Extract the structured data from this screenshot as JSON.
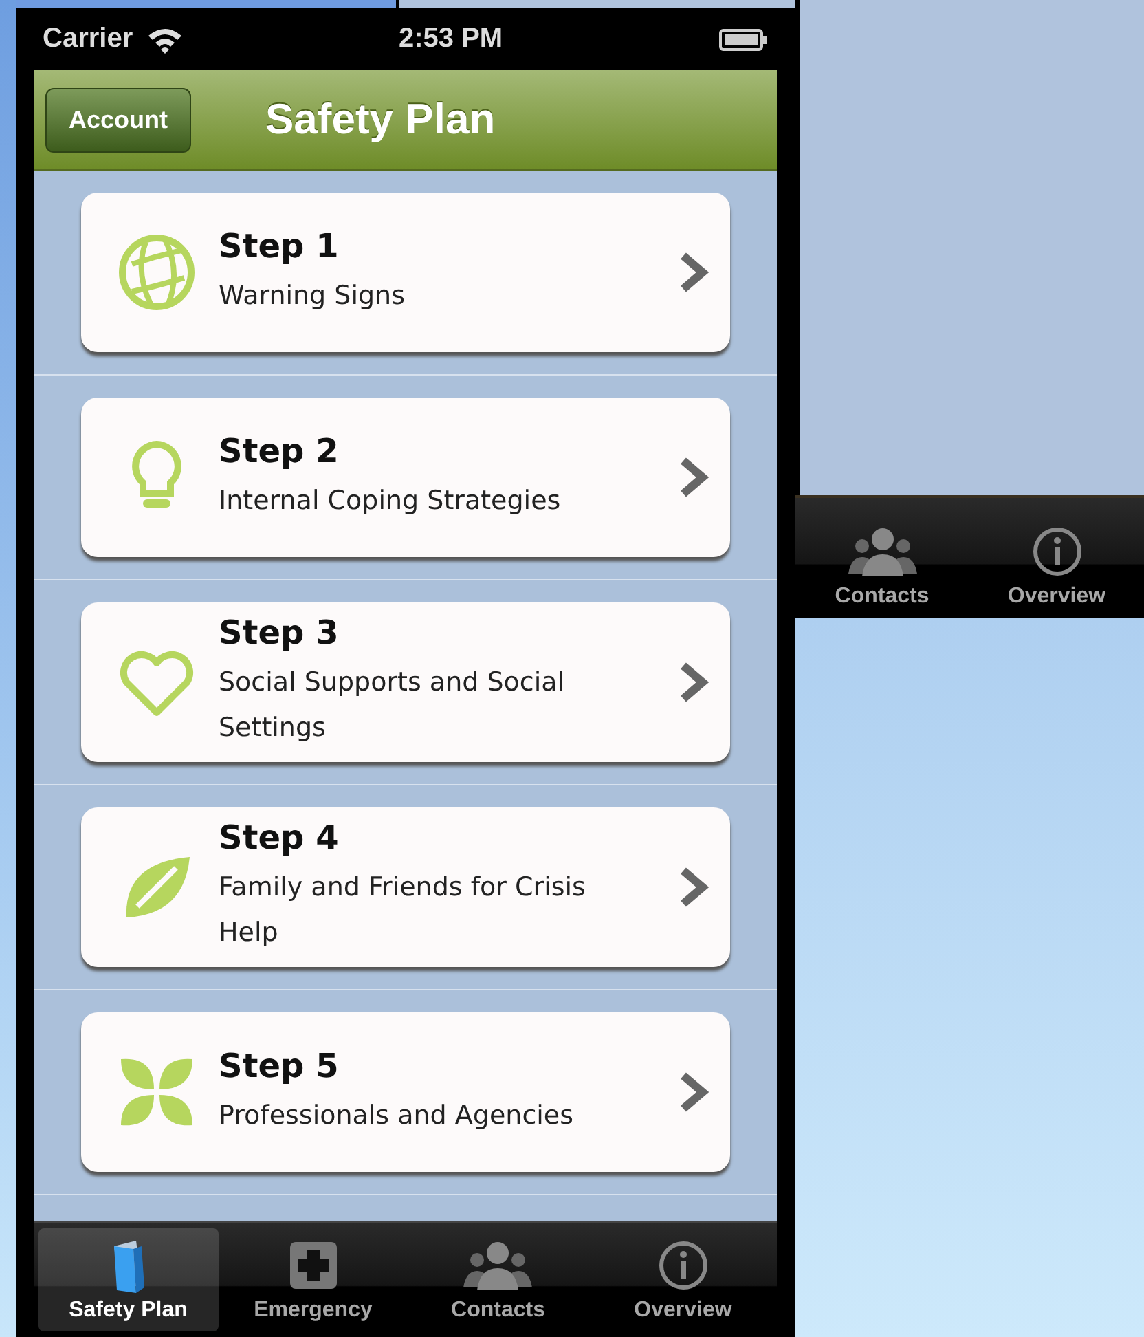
{
  "status_bar": {
    "carrier": "Carrier",
    "time": "2:53 PM"
  },
  "nav_bar": {
    "back_button": "Account",
    "title": "Safety Plan"
  },
  "steps": [
    {
      "title": "Step 1",
      "subtitle": "Warning Signs",
      "kind": "globe"
    },
    {
      "title": "Step 2",
      "subtitle": "Internal Coping Strategies",
      "kind": "bulb"
    },
    {
      "title": "Step 3",
      "subtitle": "Social Supports and Social Settings",
      "kind": "heart"
    },
    {
      "title": "Step 4",
      "subtitle": "Family and Friends for Crisis Help",
      "kind": "leaf"
    },
    {
      "title": "Step 5",
      "subtitle": "Professionals and Agencies",
      "kind": "petals"
    }
  ],
  "tab_bar": [
    {
      "label": "Safety Plan",
      "kind": "book",
      "selected": true
    },
    {
      "label": "Emergency",
      "kind": "plus",
      "selected": false
    },
    {
      "label": "Contacts",
      "kind": "people",
      "selected": false
    },
    {
      "label": "Overview",
      "kind": "info",
      "selected": false
    }
  ],
  "background_tab_bar": [
    {
      "label": "Contacts",
      "kind": "people",
      "selected": false
    },
    {
      "label": "Overview",
      "kind": "info",
      "selected": false
    }
  ]
}
